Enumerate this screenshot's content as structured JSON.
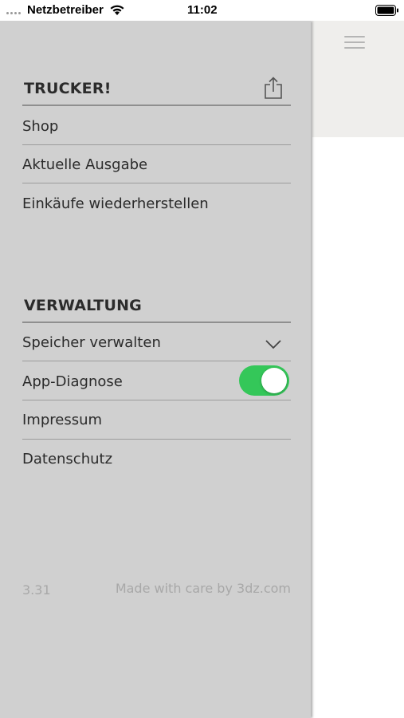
{
  "status_bar": {
    "carrier": "Netzbetreiber",
    "time": "11:02"
  },
  "drawer": {
    "section_app": {
      "title": "TRUCKER!",
      "items": [
        {
          "label": "Shop"
        },
        {
          "label": "Aktuelle Ausgabe"
        },
        {
          "label": "Einkäufe wiederherstellen"
        }
      ]
    },
    "section_admin": {
      "title": "VERWALTUNG",
      "items": [
        {
          "label": "Speicher verwalten"
        },
        {
          "label": "App-Diagnose",
          "toggle_on": true
        },
        {
          "label": "Impressum"
        },
        {
          "label": "Datenschutz"
        }
      ]
    },
    "footer": {
      "version": "3.31",
      "credit": "Made with care by 3dz.com"
    }
  },
  "colors": {
    "drawer_bg": "#d0d0d0",
    "toggle_on": "#34c759",
    "header_bg": "#efeeec"
  },
  "icons": [
    "share-icon",
    "chevron-down-icon",
    "hamburger-menu-icon",
    "wifi-icon",
    "battery-icon"
  ]
}
